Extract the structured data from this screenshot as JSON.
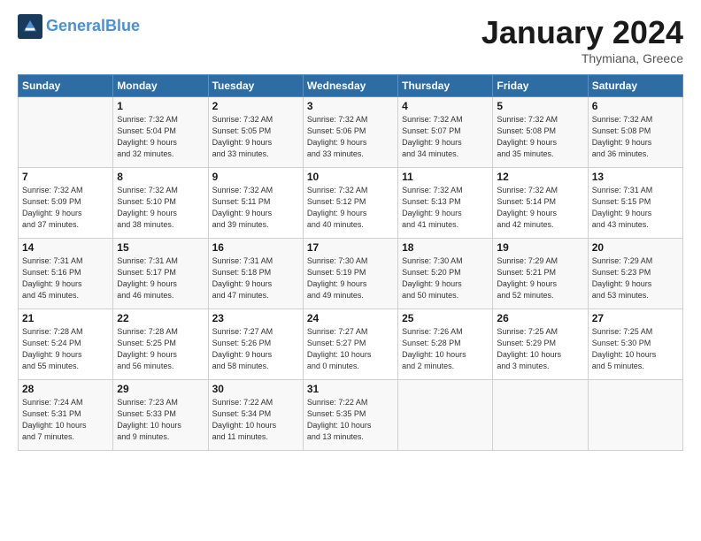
{
  "header": {
    "logo_line1": "General",
    "logo_line2": "Blue",
    "month_title": "January 2024",
    "location": "Thymiana, Greece"
  },
  "weekdays": [
    "Sunday",
    "Monday",
    "Tuesday",
    "Wednesday",
    "Thursday",
    "Friday",
    "Saturday"
  ],
  "weeks": [
    [
      {
        "day": "",
        "info": ""
      },
      {
        "day": "1",
        "info": "Sunrise: 7:32 AM\nSunset: 5:04 PM\nDaylight: 9 hours\nand 32 minutes."
      },
      {
        "day": "2",
        "info": "Sunrise: 7:32 AM\nSunset: 5:05 PM\nDaylight: 9 hours\nand 33 minutes."
      },
      {
        "day": "3",
        "info": "Sunrise: 7:32 AM\nSunset: 5:06 PM\nDaylight: 9 hours\nand 33 minutes."
      },
      {
        "day": "4",
        "info": "Sunrise: 7:32 AM\nSunset: 5:07 PM\nDaylight: 9 hours\nand 34 minutes."
      },
      {
        "day": "5",
        "info": "Sunrise: 7:32 AM\nSunset: 5:08 PM\nDaylight: 9 hours\nand 35 minutes."
      },
      {
        "day": "6",
        "info": "Sunrise: 7:32 AM\nSunset: 5:08 PM\nDaylight: 9 hours\nand 36 minutes."
      }
    ],
    [
      {
        "day": "7",
        "info": "Sunrise: 7:32 AM\nSunset: 5:09 PM\nDaylight: 9 hours\nand 37 minutes."
      },
      {
        "day": "8",
        "info": "Sunrise: 7:32 AM\nSunset: 5:10 PM\nDaylight: 9 hours\nand 38 minutes."
      },
      {
        "day": "9",
        "info": "Sunrise: 7:32 AM\nSunset: 5:11 PM\nDaylight: 9 hours\nand 39 minutes."
      },
      {
        "day": "10",
        "info": "Sunrise: 7:32 AM\nSunset: 5:12 PM\nDaylight: 9 hours\nand 40 minutes."
      },
      {
        "day": "11",
        "info": "Sunrise: 7:32 AM\nSunset: 5:13 PM\nDaylight: 9 hours\nand 41 minutes."
      },
      {
        "day": "12",
        "info": "Sunrise: 7:32 AM\nSunset: 5:14 PM\nDaylight: 9 hours\nand 42 minutes."
      },
      {
        "day": "13",
        "info": "Sunrise: 7:31 AM\nSunset: 5:15 PM\nDaylight: 9 hours\nand 43 minutes."
      }
    ],
    [
      {
        "day": "14",
        "info": "Sunrise: 7:31 AM\nSunset: 5:16 PM\nDaylight: 9 hours\nand 45 minutes."
      },
      {
        "day": "15",
        "info": "Sunrise: 7:31 AM\nSunset: 5:17 PM\nDaylight: 9 hours\nand 46 minutes."
      },
      {
        "day": "16",
        "info": "Sunrise: 7:31 AM\nSunset: 5:18 PM\nDaylight: 9 hours\nand 47 minutes."
      },
      {
        "day": "17",
        "info": "Sunrise: 7:30 AM\nSunset: 5:19 PM\nDaylight: 9 hours\nand 49 minutes."
      },
      {
        "day": "18",
        "info": "Sunrise: 7:30 AM\nSunset: 5:20 PM\nDaylight: 9 hours\nand 50 minutes."
      },
      {
        "day": "19",
        "info": "Sunrise: 7:29 AM\nSunset: 5:21 PM\nDaylight: 9 hours\nand 52 minutes."
      },
      {
        "day": "20",
        "info": "Sunrise: 7:29 AM\nSunset: 5:23 PM\nDaylight: 9 hours\nand 53 minutes."
      }
    ],
    [
      {
        "day": "21",
        "info": "Sunrise: 7:28 AM\nSunset: 5:24 PM\nDaylight: 9 hours\nand 55 minutes."
      },
      {
        "day": "22",
        "info": "Sunrise: 7:28 AM\nSunset: 5:25 PM\nDaylight: 9 hours\nand 56 minutes."
      },
      {
        "day": "23",
        "info": "Sunrise: 7:27 AM\nSunset: 5:26 PM\nDaylight: 9 hours\nand 58 minutes."
      },
      {
        "day": "24",
        "info": "Sunrise: 7:27 AM\nSunset: 5:27 PM\nDaylight: 10 hours\nand 0 minutes."
      },
      {
        "day": "25",
        "info": "Sunrise: 7:26 AM\nSunset: 5:28 PM\nDaylight: 10 hours\nand 2 minutes."
      },
      {
        "day": "26",
        "info": "Sunrise: 7:25 AM\nSunset: 5:29 PM\nDaylight: 10 hours\nand 3 minutes."
      },
      {
        "day": "27",
        "info": "Sunrise: 7:25 AM\nSunset: 5:30 PM\nDaylight: 10 hours\nand 5 minutes."
      }
    ],
    [
      {
        "day": "28",
        "info": "Sunrise: 7:24 AM\nSunset: 5:31 PM\nDaylight: 10 hours\nand 7 minutes."
      },
      {
        "day": "29",
        "info": "Sunrise: 7:23 AM\nSunset: 5:33 PM\nDaylight: 10 hours\nand 9 minutes."
      },
      {
        "day": "30",
        "info": "Sunrise: 7:22 AM\nSunset: 5:34 PM\nDaylight: 10 hours\nand 11 minutes."
      },
      {
        "day": "31",
        "info": "Sunrise: 7:22 AM\nSunset: 5:35 PM\nDaylight: 10 hours\nand 13 minutes."
      },
      {
        "day": "",
        "info": ""
      },
      {
        "day": "",
        "info": ""
      },
      {
        "day": "",
        "info": ""
      }
    ]
  ]
}
